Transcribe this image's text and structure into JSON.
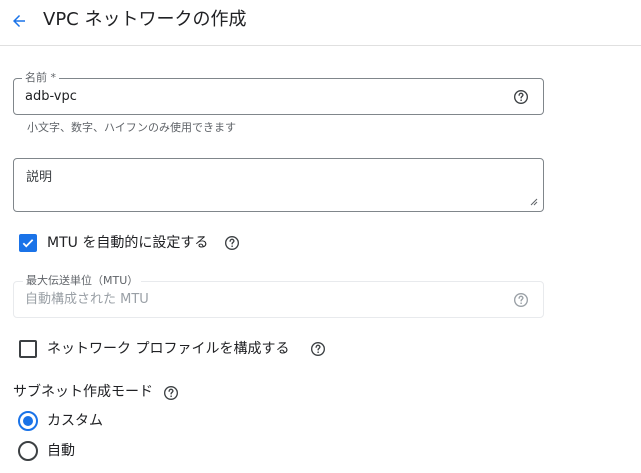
{
  "header": {
    "title": "VPC ネットワークの作成",
    "back_icon": "arrow-back-icon"
  },
  "colors": {
    "accent": "#1a73e8",
    "border": "#80868b",
    "muted_text": "#5f6368",
    "disabled_text": "#9aa0a6"
  },
  "name_field": {
    "label": "名前 *",
    "value": "adb-vpc",
    "hint": "小文字、数字、ハイフンのみ使用できます"
  },
  "description_field": {
    "placeholder": "説明"
  },
  "mtu_auto": {
    "label": "MTU を自動的に設定する",
    "checked": true
  },
  "mtu_field": {
    "label": "最大伝送単位（MTU）",
    "placeholder": "自動構成された MTU",
    "disabled": true
  },
  "network_profile": {
    "label": "ネットワーク プロファイルを構成する",
    "checked": false
  },
  "subnet_mode": {
    "title": "サブネット作成モード",
    "options": [
      {
        "label": "カスタム",
        "selected": true
      },
      {
        "label": "自動",
        "selected": false
      }
    ]
  }
}
